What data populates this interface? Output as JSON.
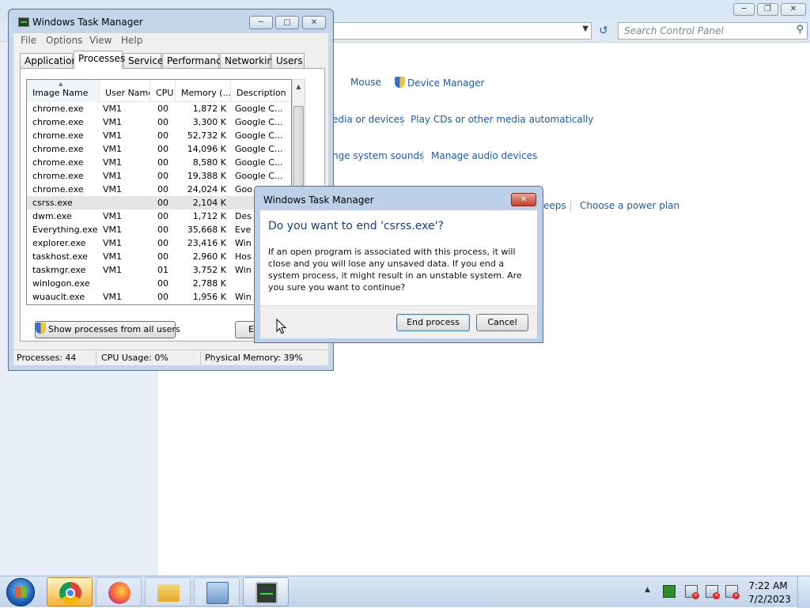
{
  "control_panel": {
    "search_placeholder": "Search Control Panel",
    "links": {
      "mouse": "Mouse",
      "device_manager": "Device Manager",
      "media_devices": "edia or devices",
      "play_cds": "Play CDs or other media automatically",
      "system_sounds": "nge system sounds",
      "manage_audio": "Manage audio devices",
      "sleeps": "eeps",
      "power_plan": "Choose a power plan"
    }
  },
  "task_manager": {
    "title": "Windows Task Manager",
    "menu": [
      "File",
      "Options",
      "View",
      "Help"
    ],
    "tabs": [
      "Applications",
      "Processes",
      "Services",
      "Performance",
      "Networking",
      "Users"
    ],
    "active_tab": "Processes",
    "columns": [
      "Image Name",
      "User Name",
      "CPU",
      "Memory (...",
      "Description"
    ],
    "rows": [
      [
        "chrome.exe",
        "VM1",
        "00",
        "1,872 K",
        "Google C..."
      ],
      [
        "chrome.exe",
        "VM1",
        "00",
        "3,300 K",
        "Google C..."
      ],
      [
        "chrome.exe",
        "VM1",
        "00",
        "52,732 K",
        "Google C..."
      ],
      [
        "chrome.exe",
        "VM1",
        "00",
        "14,096 K",
        "Google C..."
      ],
      [
        "chrome.exe",
        "VM1",
        "00",
        "8,580 K",
        "Google C..."
      ],
      [
        "chrome.exe",
        "VM1",
        "00",
        "19,388 K",
        "Google C..."
      ],
      [
        "chrome.exe",
        "VM1",
        "00",
        "24,024 K",
        "Goo"
      ],
      [
        "csrss.exe",
        "",
        "00",
        "2,104 K",
        ""
      ],
      [
        "dwm.exe",
        "VM1",
        "00",
        "1,712 K",
        "Des"
      ],
      [
        "Everything.exe",
        "VM1",
        "00",
        "35,668 K",
        "Eve"
      ],
      [
        "explorer.exe",
        "VM1",
        "00",
        "23,416 K",
        "Win"
      ],
      [
        "taskhost.exe",
        "VM1",
        "00",
        "2,960 K",
        "Hos"
      ],
      [
        "taskmgr.exe",
        "VM1",
        "01",
        "3,752 K",
        "Win"
      ],
      [
        "winlogon.exe",
        "",
        "00",
        "2,788 K",
        ""
      ],
      [
        "wuauclt.exe",
        "VM1",
        "00",
        "1,956 K",
        "Win"
      ]
    ],
    "selected_row": 7,
    "show_all_button": "Show processes from all users",
    "end_process_partial": "E",
    "status": {
      "processes": "Processes: 44",
      "cpu": "CPU Usage: 0%",
      "memory": "Physical Memory: 39%"
    }
  },
  "dialog": {
    "title": "Windows Task Manager",
    "heading": "Do you want to end 'csrss.exe'?",
    "body": "If an open program is associated with this process, it will close and you will lose any unsaved data. If you end a system process, it might result in an unstable system. Are you sure you want to continue?",
    "end_button": "End process",
    "cancel_button": "Cancel"
  },
  "taskbar": {
    "apps": [
      "chrome",
      "firefox",
      "file-explorer",
      "control-panel",
      "task-manager"
    ],
    "active_app": "task-manager",
    "time": "7:22 AM",
    "date": "7/2/2023"
  },
  "colors": {
    "link": "#1e5ba8",
    "dialog_heading": "#173e8e",
    "title_glass": "#c4d6ec"
  }
}
